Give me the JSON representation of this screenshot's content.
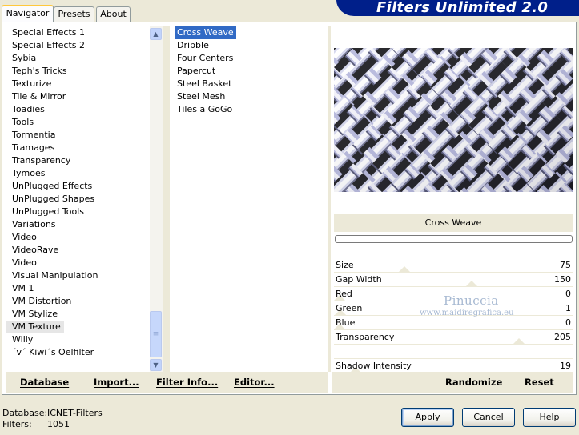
{
  "tabs": [
    "Navigator",
    "Presets",
    "About"
  ],
  "app_title": "Filters Unlimited 2.0",
  "categories": [
    "Special Effects 1",
    "Special Effects 2",
    "Sybia",
    "Teph's Tricks",
    "Texturize",
    "Tile & Mirror",
    "Toadies",
    "Tools",
    "Tormentia",
    "Tramages",
    "Transparency",
    "Tymoes",
    "UnPlugged Effects",
    "UnPlugged Shapes",
    "UnPlugged Tools",
    "Variations",
    "Video",
    "VideoRave",
    "Video",
    "Visual Manipulation",
    "VM 1",
    "VM Distortion",
    "VM Stylize",
    "VM Texture",
    "Willy",
    "´v´ Kiwi´s Oelfilter"
  ],
  "selected_category": "VM Texture",
  "filters": [
    "Cross Weave",
    "Dribble",
    "Four Centers",
    "Papercut",
    "Steel Basket",
    "Steel Mesh",
    "Tiles a GoGo"
  ],
  "selected_filter": "Cross Weave",
  "preview": {
    "filter_name": "Cross Weave",
    "progress": 0
  },
  "params": [
    {
      "name": "Size",
      "value": "75",
      "level": 0.29
    },
    {
      "name": "Gap Width",
      "value": "150",
      "level": 0.59
    },
    {
      "name": "Red",
      "value": "0",
      "level": 0
    },
    {
      "name": "Green",
      "value": "1",
      "level": 0.004
    },
    {
      "name": "Blue",
      "value": "0",
      "level": 0
    },
    {
      "name": "Transparency",
      "value": "205",
      "level": 0.8
    },
    {
      "name": "Shadow Intensity",
      "value": "19",
      "level": 0.07
    }
  ],
  "watermark": {
    "name": "Pinuccia",
    "site": "www.maidiregrafica.eu"
  },
  "bottom_left_buttons": [
    "Database",
    "Import...",
    "Filter Info...",
    "Editor..."
  ],
  "bottom_right_buttons": [
    "Randomize",
    "Reset"
  ],
  "status": {
    "database_label": "Database:",
    "database_value": "ICNET-Filters",
    "filters_label": "Filters:",
    "filters_value": "1051"
  },
  "dialog_buttons": {
    "apply": "Apply",
    "cancel": "Cancel",
    "help": "Help"
  },
  "colors": {
    "banner": "#001f8a",
    "selection": "#316ac5",
    "panel_bg": "#ece9d8"
  }
}
